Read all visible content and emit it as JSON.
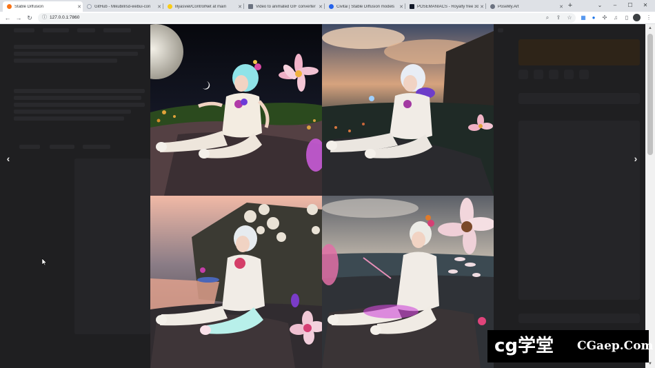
{
  "browser": {
    "tabs": [
      {
        "title": "Stable Diffusion",
        "favicon_color": "#f97316",
        "active": true
      },
      {
        "title": "GitHub - Mikubill/sd-webui-con",
        "favicon_color": "#e5e7eb",
        "active": false
      },
      {
        "title": "lllyasviel/ControlNet at main",
        "favicon_color": "#facc15",
        "active": false
      },
      {
        "title": "Video to animated GIF converter",
        "favicon_color": "#6b7280",
        "active": false
      },
      {
        "title": "Civitai | Stable Diffusion models",
        "favicon_color": "#2563eb",
        "active": false
      },
      {
        "title": "POSEMANIACS - Royalty free 3d",
        "favicon_color": "#111827",
        "active": false
      },
      {
        "title": "PoseMy.Art",
        "favicon_color": "#6b7280",
        "active": false
      }
    ],
    "new_tab_label": "+",
    "window_controls": {
      "collapse": "⌄",
      "minimize": "–",
      "maximize": "☐",
      "close": "✕"
    },
    "url": "127.0.0.1:7860"
  },
  "viewer": {
    "prev_label": "‹",
    "next_label": "›",
    "images": [
      {
        "name": "gallery-image-1",
        "alt": "generated image 1"
      },
      {
        "name": "gallery-image-2",
        "alt": "generated image 2"
      },
      {
        "name": "gallery-image-3",
        "alt": "generated image 3"
      },
      {
        "name": "gallery-image-4",
        "alt": "generated image 4"
      }
    ]
  },
  "watermark": {
    "logo": "cg学堂",
    "site": "CGaep.Com"
  },
  "colors": {
    "accent": "#f97316",
    "overlay": "#0e0e10"
  }
}
